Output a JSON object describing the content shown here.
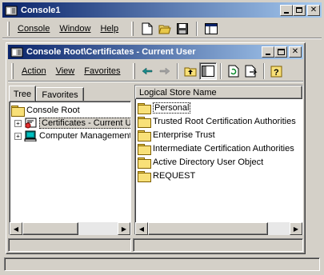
{
  "app": {
    "title": "Console1"
  },
  "main_menu": {
    "console": "Console",
    "window": "Window",
    "help": "Help"
  },
  "child": {
    "title": "Console Root\\Certificates - Current User"
  },
  "child_menu": {
    "action": "Action",
    "view": "View",
    "favorites": "Favorites"
  },
  "tabs": {
    "tree": "Tree",
    "favorites": "Favorites"
  },
  "tree": {
    "root": "Console Root",
    "items": [
      "Certificates - Current User",
      "Computer Management"
    ]
  },
  "list": {
    "column_header": "Logical Store Name",
    "items": [
      "Personal",
      "Trusted Root Certification Authorities",
      "Enterprise Trust",
      "Intermediate Certification Authorities",
      "Active Directory User Object",
      "REQUEST"
    ]
  },
  "colors": {
    "titlebar_active": "#0a246a",
    "titlebar_gradient_end": "#a6caf0",
    "face": "#d4d0c8",
    "selection": "#0a246a"
  },
  "icons": [
    "app-icon",
    "minimize-icon",
    "restore-icon",
    "close-icon",
    "new-icon",
    "open-icon",
    "save-icon",
    "window-icon",
    "back-icon",
    "forward-icon",
    "up-icon",
    "show-tree-icon",
    "refresh-icon",
    "export-icon",
    "help-icon",
    "folder-icon",
    "certificate-icon",
    "computer-icon"
  ]
}
